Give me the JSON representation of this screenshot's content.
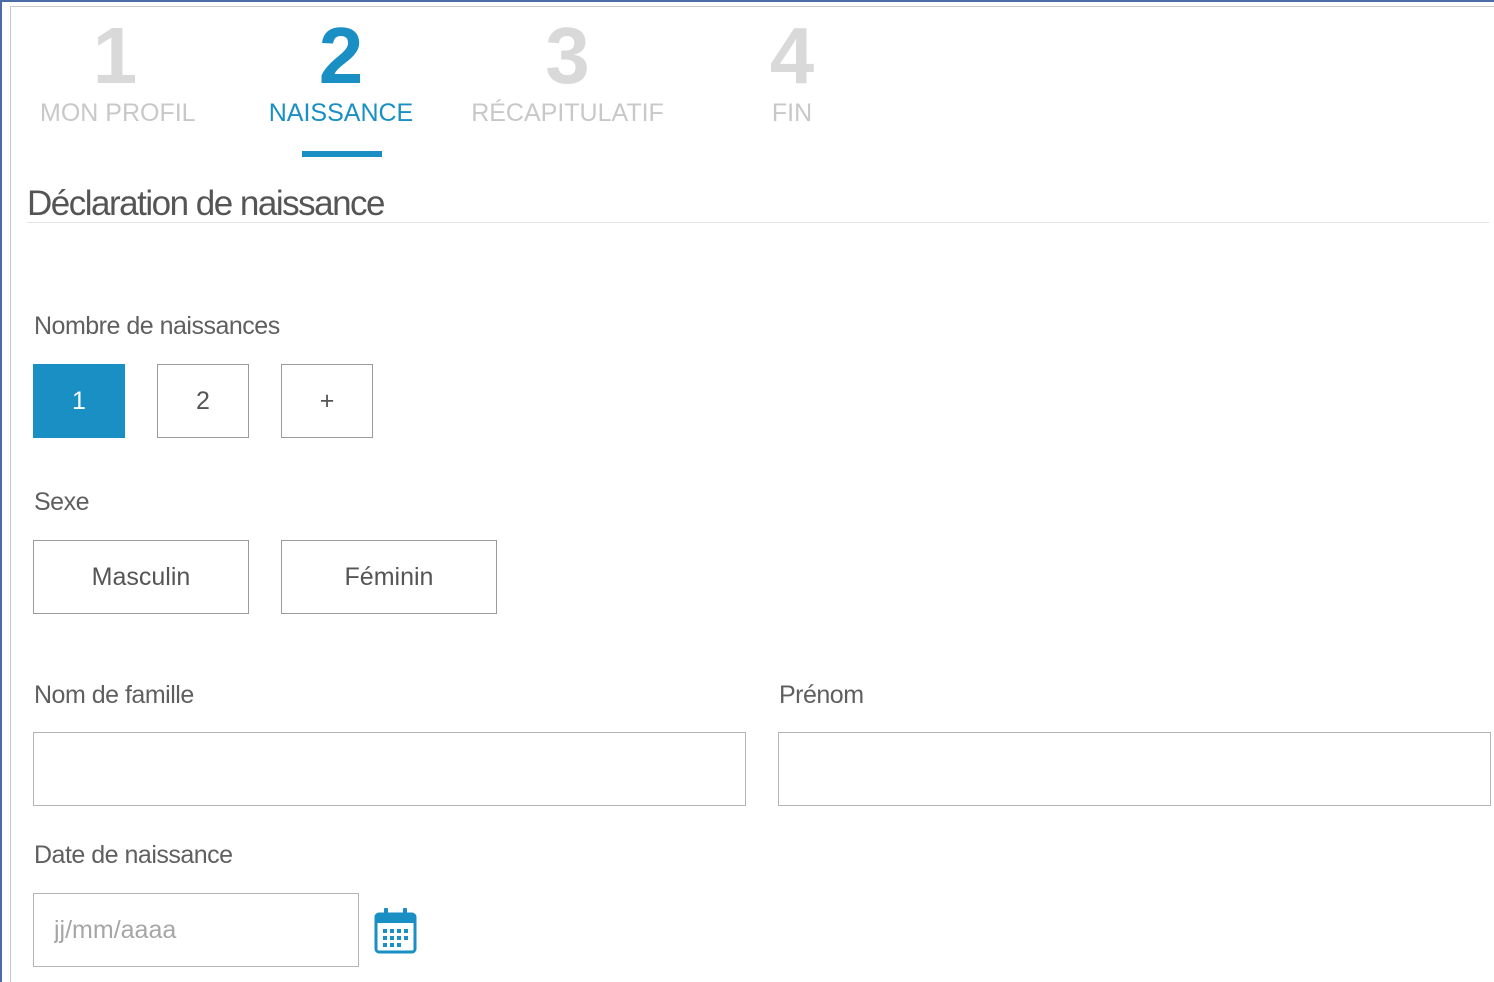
{
  "stepper": {
    "steps": [
      {
        "number": "1",
        "label": "MON PROFIL",
        "state": "inactive"
      },
      {
        "number": "2",
        "label": "NAISSANCE",
        "state": "active"
      },
      {
        "number": "3",
        "label": "RÉCAPITULATIF",
        "state": "inactive"
      },
      {
        "number": "4",
        "label": "FIN",
        "state": "inactive"
      }
    ]
  },
  "form": {
    "title": "Déclaration de naissance",
    "births_count": {
      "label": "Nombre de naissances",
      "options": [
        "1",
        "2",
        "+"
      ],
      "selected": "1"
    },
    "sex": {
      "label": "Sexe",
      "options": [
        "Masculin",
        "Féminin"
      ]
    },
    "last_name": {
      "label": "Nom de famille",
      "value": ""
    },
    "first_name": {
      "label": "Prénom",
      "value": ""
    },
    "birth_date": {
      "label": "Date de naissance",
      "placeholder": "jj/mm/aaaa",
      "value": ""
    }
  },
  "colors": {
    "accent": "#1a8fc4",
    "inactive_step": "#d9d9d9",
    "border": "#9a9a9a"
  },
  "icons": {
    "calendar": "calendar-icon"
  }
}
